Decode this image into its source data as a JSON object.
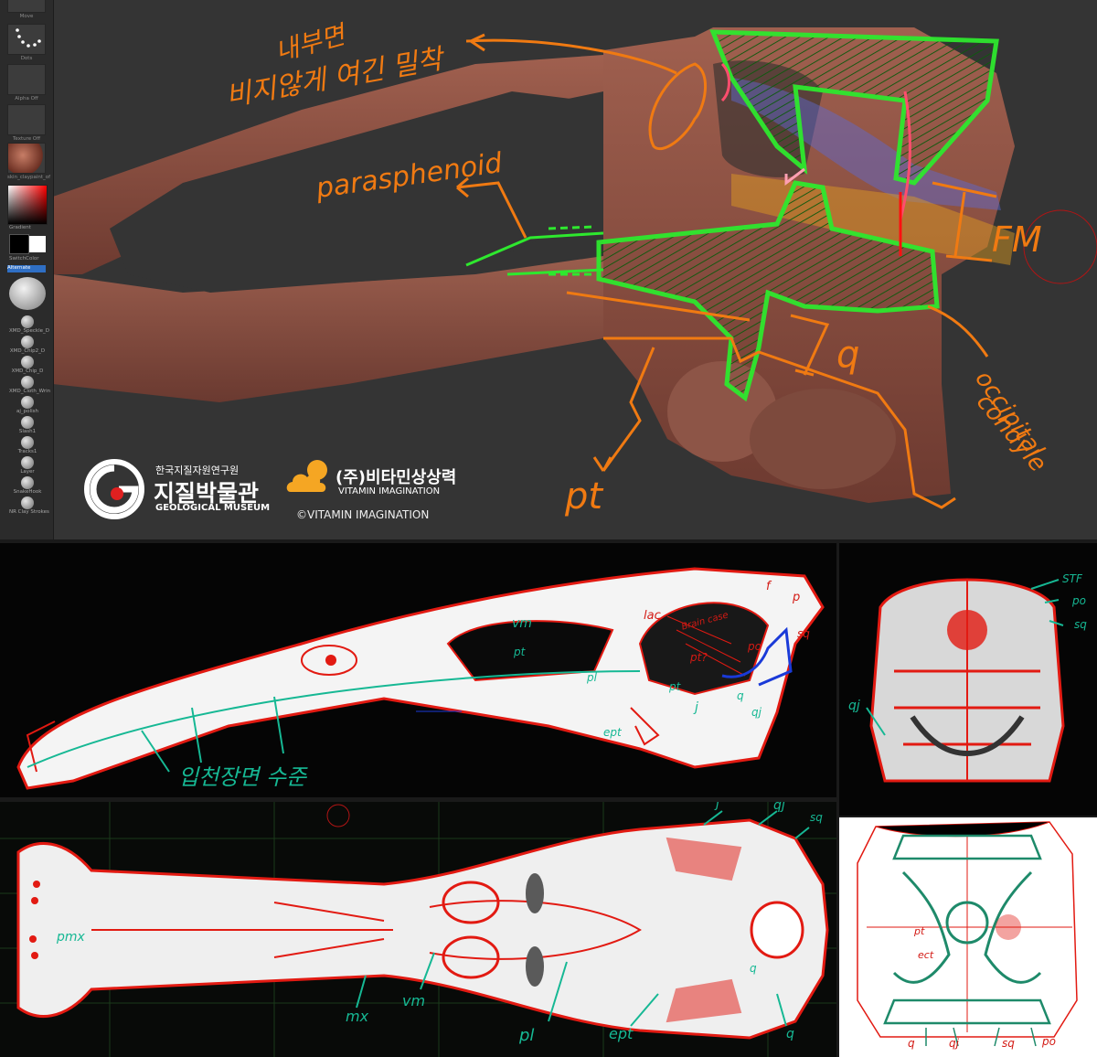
{
  "sidebar": {
    "tools": [
      {
        "label": "Move",
        "icon": "move-brush-icon"
      },
      {
        "label": "Dots",
        "icon": "dots-stroke-icon"
      },
      {
        "label": "Alpha Off",
        "icon": "alpha-icon"
      },
      {
        "label": "Texture Off",
        "icon": "texture-icon"
      },
      {
        "label": "skin_claypaint_of",
        "icon": "material-sphere-icon"
      }
    ],
    "gradient_label": "Gradient",
    "switch_color_label": "SwitchColor",
    "alternate_label": "Alternate",
    "brushes": [
      "XMD_Speckle_D",
      "XMD_Chip2_D",
      "XMD_Chip_D",
      "XMD_Cloth_Wrin",
      "aj_polish",
      "Slash1",
      "Tracks1",
      "Layer",
      "SnakeHook",
      "NR Clay Strokes"
    ]
  },
  "top_annotations": {
    "korean_line1": "내부면",
    "korean_line2": "비지않게 여긴 밀착",
    "parasphenoid": "parasphenoid",
    "fm": "FM",
    "q": "q",
    "occipital": "occipital",
    "condyle": "condyle",
    "pt": "pt"
  },
  "logos": {
    "museum_line1": "한국지질자원연구원",
    "museum_line2": "지질박물관",
    "museum_line3": "GEOLOGICAL MUSEUM",
    "vitamin_line1": "(주)비타민상상력",
    "vitamin_line2": "VITAMIN IMAGINATION",
    "copyright": "©VITAMIN IMAGINATION"
  },
  "lateral_view_labels": {
    "vm": "vm",
    "lac": "lac",
    "f": "f",
    "p": "p",
    "braincase": "Brain case",
    "pt_q": "pt?",
    "po": "po",
    "sq": "sq",
    "pt_upper": "pt",
    "pl": "pl",
    "pt_lower": "pt",
    "j": "j",
    "q": "q",
    "qj": "qj",
    "ept": "ept",
    "palate_note": "입천장면 수준"
  },
  "posterior_view_labels": {
    "stf": "STF",
    "po": "po",
    "sq": "sq",
    "qj": "qj"
  },
  "ventral_view_labels": {
    "j": "j",
    "qj": "qj",
    "sq": "sq",
    "pmx": "pmx",
    "mx": "mx",
    "vm": "vm",
    "pl": "pl",
    "ept": "ept",
    "q": "q",
    "q_lower": "q"
  },
  "dorsal_view_labels": {
    "pt": "pt",
    "ect": "ect",
    "q": "q",
    "qj": "qj",
    "sq": "sq",
    "po": "po"
  },
  "colors": {
    "orange": "#f07a12",
    "green": "#2ee82e",
    "red": "#e21a12",
    "teal": "#16b894",
    "bone": "#8e4f42"
  }
}
